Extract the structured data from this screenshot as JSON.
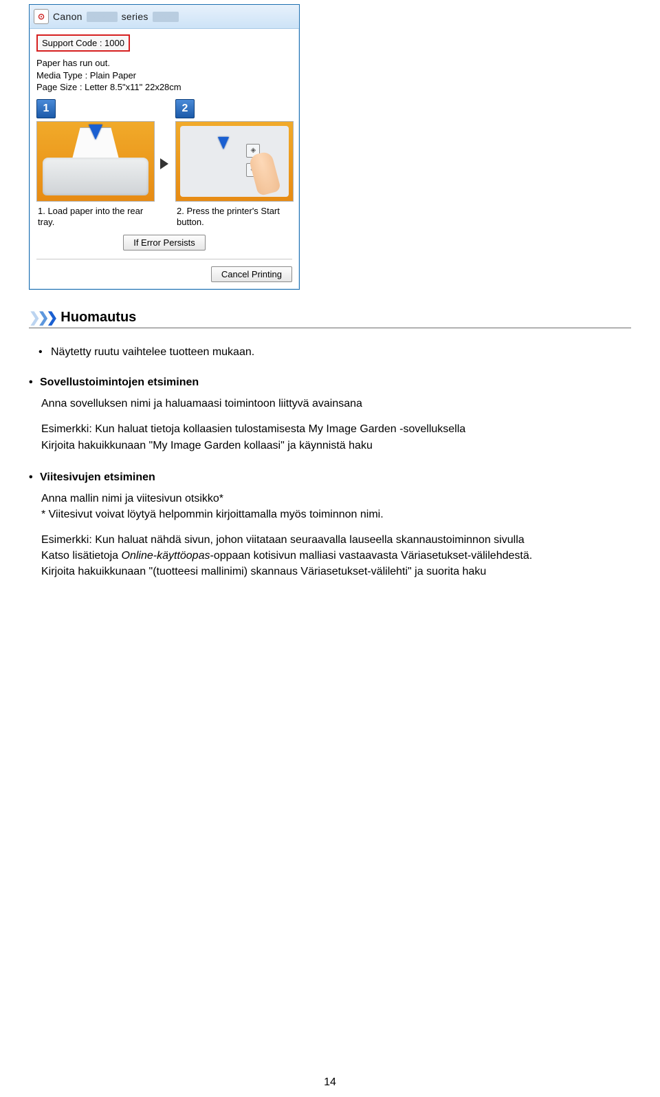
{
  "dialog": {
    "brand": "Canon",
    "series": "series",
    "support_code": "Support Code : 1000",
    "info_line1": "Paper has run out.",
    "info_line2": "Media Type : Plain Paper",
    "info_line3": "Page Size : Letter 8.5\"x11\" 22x28cm",
    "step1_num": "1",
    "step1_caption": "1.  Load paper into the rear tray.",
    "step2_num": "2",
    "step2_caption": "2.  Press the printer's Start button.",
    "btn_persist": "If Error Persists",
    "btn_cancel": "Cancel Printing"
  },
  "note": {
    "title": "Huomautus",
    "line1": "Näytetty ruutu vaihtelee tuotteen mukaan."
  },
  "section1": {
    "title": "Sovellustoimintojen etsiminen",
    "p1": "Anna sovelluksen nimi ja haluamaasi toimintoon liittyvä avainsana",
    "p2a": "Esimerkki: Kun haluat tietoja kollaasien tulostamisesta My Image Garden -sovelluksella",
    "p2b": "Kirjoita hakuikkunaan \"My Image Garden kollaasi\" ja käynnistä haku"
  },
  "section2": {
    "title": "Viitesivujen etsiminen",
    "p1": "Anna mallin nimi ja viitesivun otsikko*",
    "p1b": "* Viitesivut voivat löytyä helpommin kirjoittamalla myös toiminnon nimi.",
    "p2a": "Esimerkki: Kun haluat nähdä sivun, johon viitataan seuraavalla lauseella skannaustoiminnon sivulla",
    "p2b_pre": "Katso lisätietoja ",
    "p2b_it": "Online-käyttöopas",
    "p2b_post": "-oppaan kotisivun malliasi vastaavasta Väriasetukset-välilehdestä.",
    "p3": "Kirjoita hakuikkunaan \"(tuotteesi mallinimi) skannaus Väriasetukset-välilehti\" ja suorita haku"
  },
  "page_number": "14"
}
